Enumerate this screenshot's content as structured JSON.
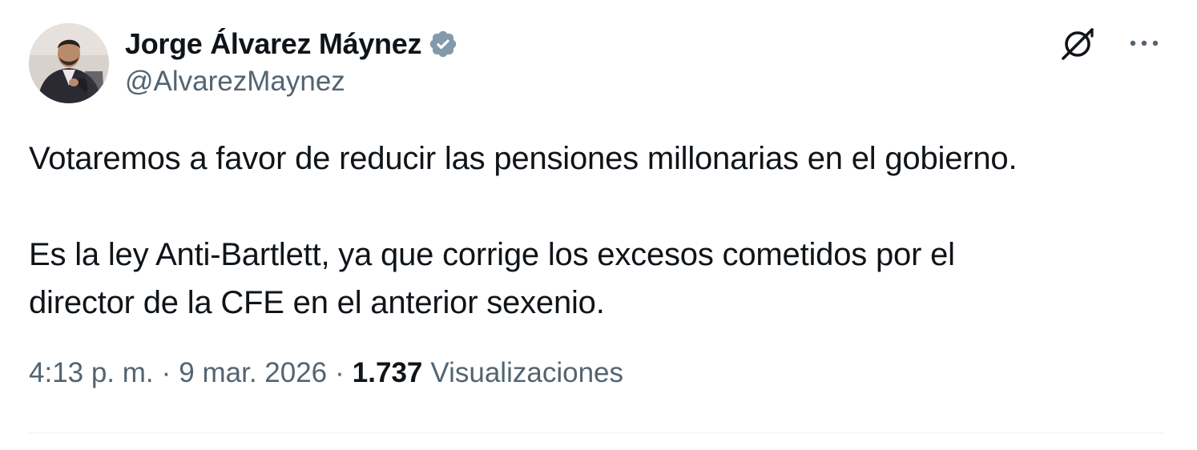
{
  "author": {
    "display_name": "Jorge Álvarez Máynez",
    "handle": "@AlvarezMaynez",
    "verified_badge_color": "#829aab"
  },
  "icons": {
    "grok": "grok-icon",
    "more": "more-options-icon",
    "verified": "verified-badge-icon"
  },
  "tweet": {
    "paragraph_1": "Votaremos a favor de reducir las pensiones millonarias en el gobierno.",
    "paragraph_2_line_1": "Es la ley Anti-Bartlett, ya que corrige los excesos cometidos por el",
    "paragraph_2_line_2": "director de la CFE en el anterior sexenio."
  },
  "meta": {
    "time": "4:13 p. m.",
    "separator": "·",
    "date": "9 mar. 2026",
    "views_count": "1.737",
    "views_label": "Visualizaciones"
  },
  "colors": {
    "text_primary": "#0f1419",
    "text_secondary": "#536471",
    "divider": "#eff3f4"
  }
}
